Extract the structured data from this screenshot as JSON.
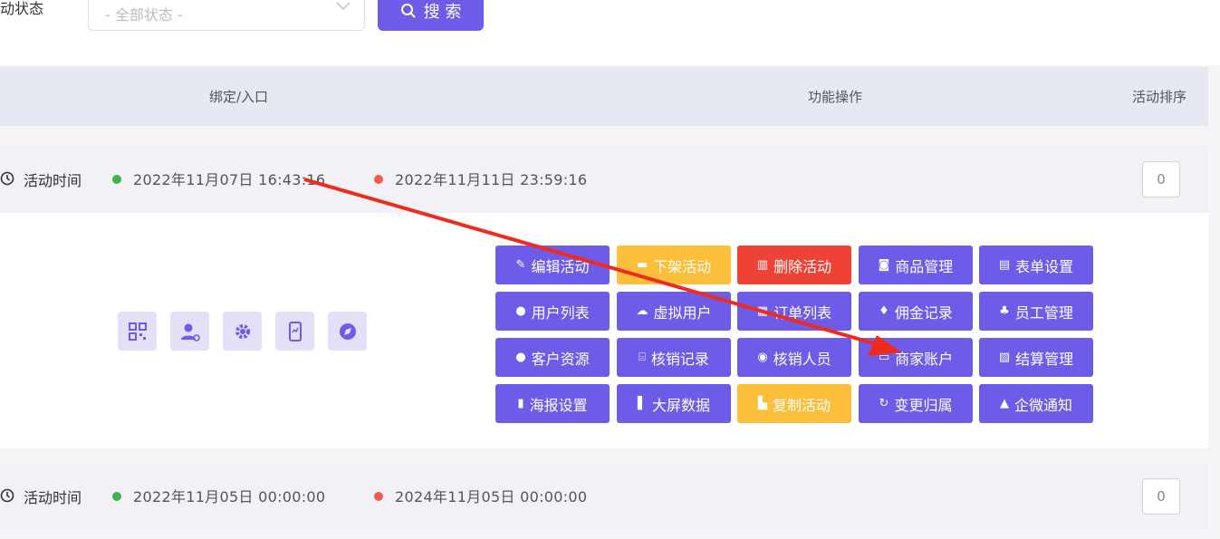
{
  "filters": {
    "status_label": "动状态",
    "status_placeholder": "- 全部状态 -",
    "search_label": "搜 索"
  },
  "table": {
    "headers": {
      "binding": "绑定/入口",
      "functions": "功能操作",
      "sort": "活动排序"
    }
  },
  "rows": [
    {
      "time_label": "活动时间",
      "start": "2022年11月07日 16:43:16",
      "end": "2022年11月11日 23:59:16",
      "sort": "0",
      "entry_icons": [
        "qrcode-icon",
        "user-link-icon",
        "gear-icon",
        "mobile-icon",
        "compass-icon"
      ],
      "actions": [
        {
          "label": "编辑活动",
          "color": "purple",
          "icon": "edit-icon"
        },
        {
          "label": "下架活动",
          "color": "yellow",
          "icon": "box-icon"
        },
        {
          "label": "删除活动",
          "color": "red",
          "icon": "trash-icon"
        },
        {
          "label": "商品管理",
          "color": "purple",
          "icon": "goods-icon"
        },
        {
          "label": "表单设置",
          "color": "purple",
          "icon": "form-icon"
        },
        {
          "label": "用户列表",
          "color": "purple",
          "icon": "user-icon"
        },
        {
          "label": "虚拟用户",
          "color": "purple",
          "icon": "cloud-icon"
        },
        {
          "label": "订单列表",
          "color": "purple",
          "icon": "order-icon"
        },
        {
          "label": "佣金记录",
          "color": "purple",
          "icon": "money-bag-icon"
        },
        {
          "label": "员工管理",
          "color": "purple",
          "icon": "staff-icon"
        },
        {
          "label": "客户资源",
          "color": "purple",
          "icon": "customer-icon"
        },
        {
          "label": "核销记录",
          "color": "purple",
          "icon": "scan-icon"
        },
        {
          "label": "核销人员",
          "color": "purple",
          "icon": "person-circle-icon"
        },
        {
          "label": "商家账户",
          "color": "purple",
          "icon": "wallet-icon"
        },
        {
          "label": "结算管理",
          "color": "purple",
          "icon": "ledger-icon"
        },
        {
          "label": "海报设置",
          "color": "purple",
          "icon": "poster-icon"
        },
        {
          "label": "大屏数据",
          "color": "purple",
          "icon": "bar-chart-icon"
        },
        {
          "label": "复制活动",
          "color": "yellow",
          "icon": "copy-icon"
        },
        {
          "label": "变更归属",
          "color": "purple",
          "icon": "refresh-icon"
        },
        {
          "label": "企微通知",
          "color": "purple",
          "icon": "bell-icon"
        }
      ]
    },
    {
      "time_label": "活动时间",
      "start": "2022年11月05日 00:00:00",
      "end": "2024年11月05日 00:00:00",
      "sort": "0"
    }
  ],
  "colors": {
    "primary": "#6c5ce7",
    "warning": "#fbbf3b",
    "danger": "#ee4237",
    "start_dot": "#3cb64a",
    "end_dot": "#ef5a4a",
    "annotation_arrow": "#f02a1c"
  }
}
